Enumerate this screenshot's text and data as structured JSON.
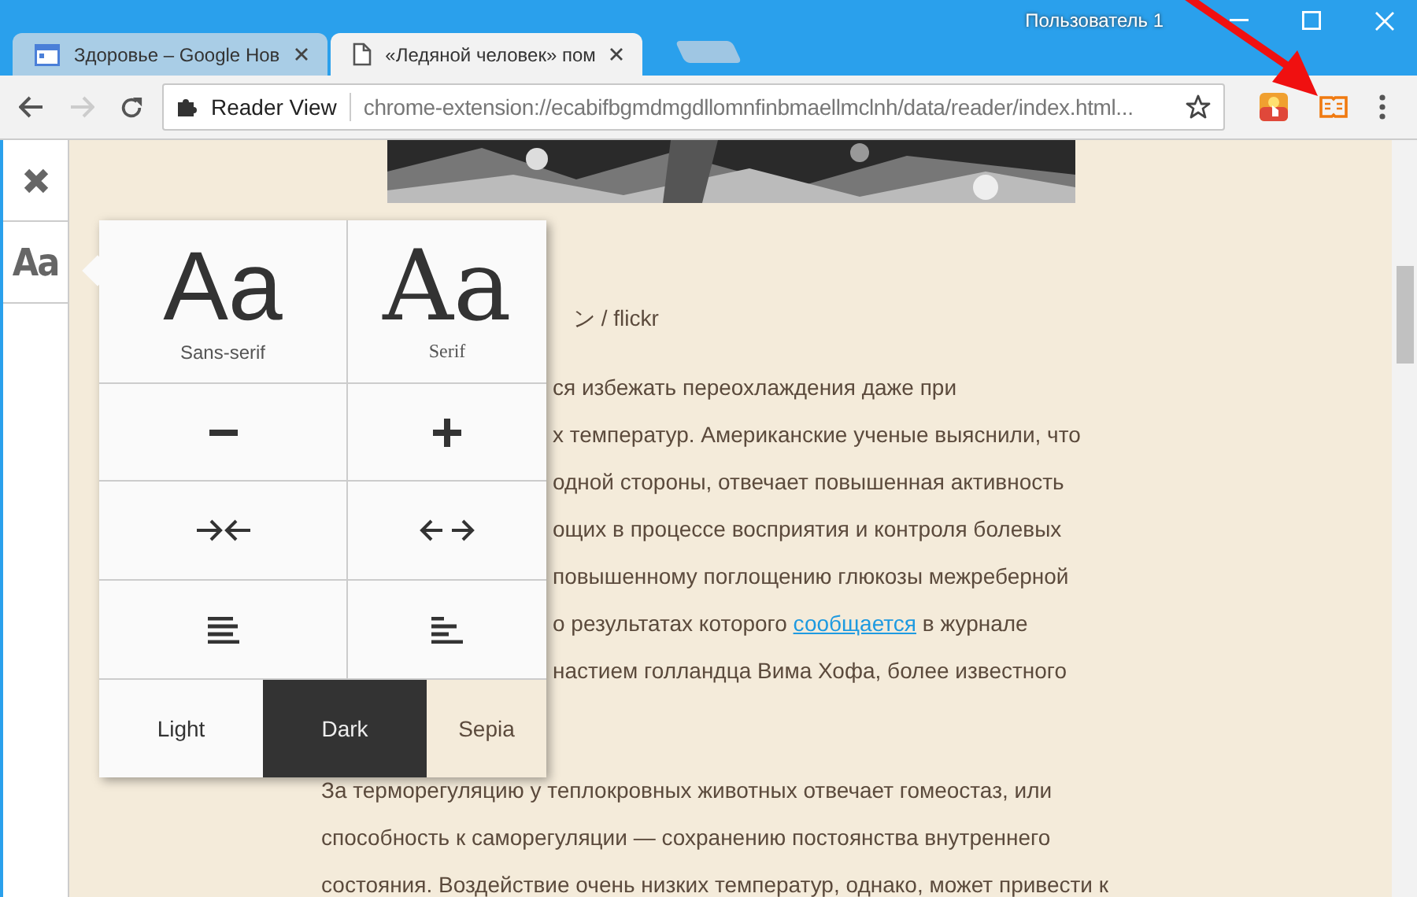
{
  "window": {
    "user": "Пользователь 1"
  },
  "tabs": [
    {
      "title": "Здоровье  – Google Нов",
      "selected": false,
      "kind": "news"
    },
    {
      "title": "«Ледяной человек» пом",
      "selected": true,
      "kind": "page"
    }
  ],
  "toolbar": {
    "chip": "Reader View",
    "url": "chrome-extension://ecabifbgmdmgdllomnfinbmaellmclnh/data/reader/index.html..."
  },
  "popup": {
    "fonts": [
      {
        "sample": "Aa",
        "label": "Sans-serif",
        "kind": "sans"
      },
      {
        "sample": "Aa",
        "label": "Serif",
        "kind": "serif"
      }
    ],
    "themes": [
      {
        "label": "Light",
        "kind": "light"
      },
      {
        "label": "Dark",
        "kind": "dark"
      },
      {
        "label": "Sepia",
        "kind": "sepia"
      }
    ]
  },
  "sidebar": {
    "text_button": "Aa"
  },
  "article": {
    "credit": "ン / flickr",
    "paragraphs": [
      {
        "kind": "partial",
        "lines": [
          {
            "text": "ся избежать переохлаждения даже при"
          },
          {
            "text": "х температур. Американские ученые выяснили, что"
          },
          {
            "text": "одной стороны, отвечает повышенная активность"
          },
          {
            "text": "ощих в процессе восприятия и контроля болевых"
          },
          {
            "text": "повышенному поглощению глюкозы межреберной"
          },
          {
            "text": "о результатах которого ",
            "link": "сообщается",
            "after": " в журнале"
          },
          {
            "text": "настием голландца Вима Хофа, более известного"
          }
        ]
      },
      {
        "kind": "full",
        "lines": [
          {
            "text": "За терморегуляцию у теплокровных животных отвечает гомеостаз, или"
          },
          {
            "text": "способность к саморегуляции — сохранению постоянства внутреннего"
          },
          {
            "text": "состояния. Воздействие очень низких температур, однако, может привести к"
          }
        ]
      }
    ]
  }
}
